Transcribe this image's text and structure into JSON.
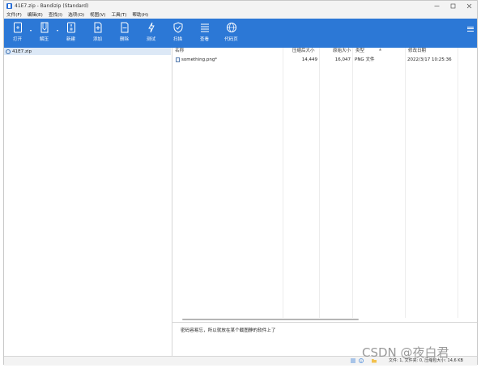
{
  "window": {
    "title": "41E7.zip - Bandizip (Standard)"
  },
  "menu": [
    "文件(F)",
    "编辑(E)",
    "查找(I)",
    "选项(O)",
    "视图(V)",
    "工具(T)",
    "帮助(H)"
  ],
  "toolbar": [
    {
      "label": "打开",
      "icon": "open-archive-icon"
    },
    {
      "label": "解压",
      "icon": "extract-icon"
    },
    {
      "label": "新建",
      "icon": "new-archive-icon"
    },
    {
      "label": "添加",
      "icon": "add-file-icon"
    },
    {
      "label": "删除",
      "icon": "delete-file-icon"
    },
    {
      "label": "测试",
      "icon": "test-icon"
    },
    {
      "label": "扫描",
      "icon": "scan-shield-icon"
    },
    {
      "label": "查看",
      "icon": "view-list-icon"
    },
    {
      "label": "代码页",
      "icon": "globe-icon"
    }
  ],
  "tree": {
    "root": "41E7.zip"
  },
  "columns": [
    "名称",
    "压缩后大小",
    "原始大小",
    "类型",
    "修改日期"
  ],
  "files": [
    {
      "name": "something.png*",
      "packed": "14,449",
      "size": "16,047",
      "type": "PNG 文件",
      "modified": "2022/3/17 10:25:36"
    }
  ],
  "description": "密码容易忘，所以就放在某个截图静的软件上了",
  "status": "文件: 1, 文件夹: 0, 压缩包大小: 14,6 KB",
  "watermark": "CSDN @夜白君",
  "colors": {
    "toolbar": "#2c78d6",
    "selection": "#dce8f6"
  }
}
